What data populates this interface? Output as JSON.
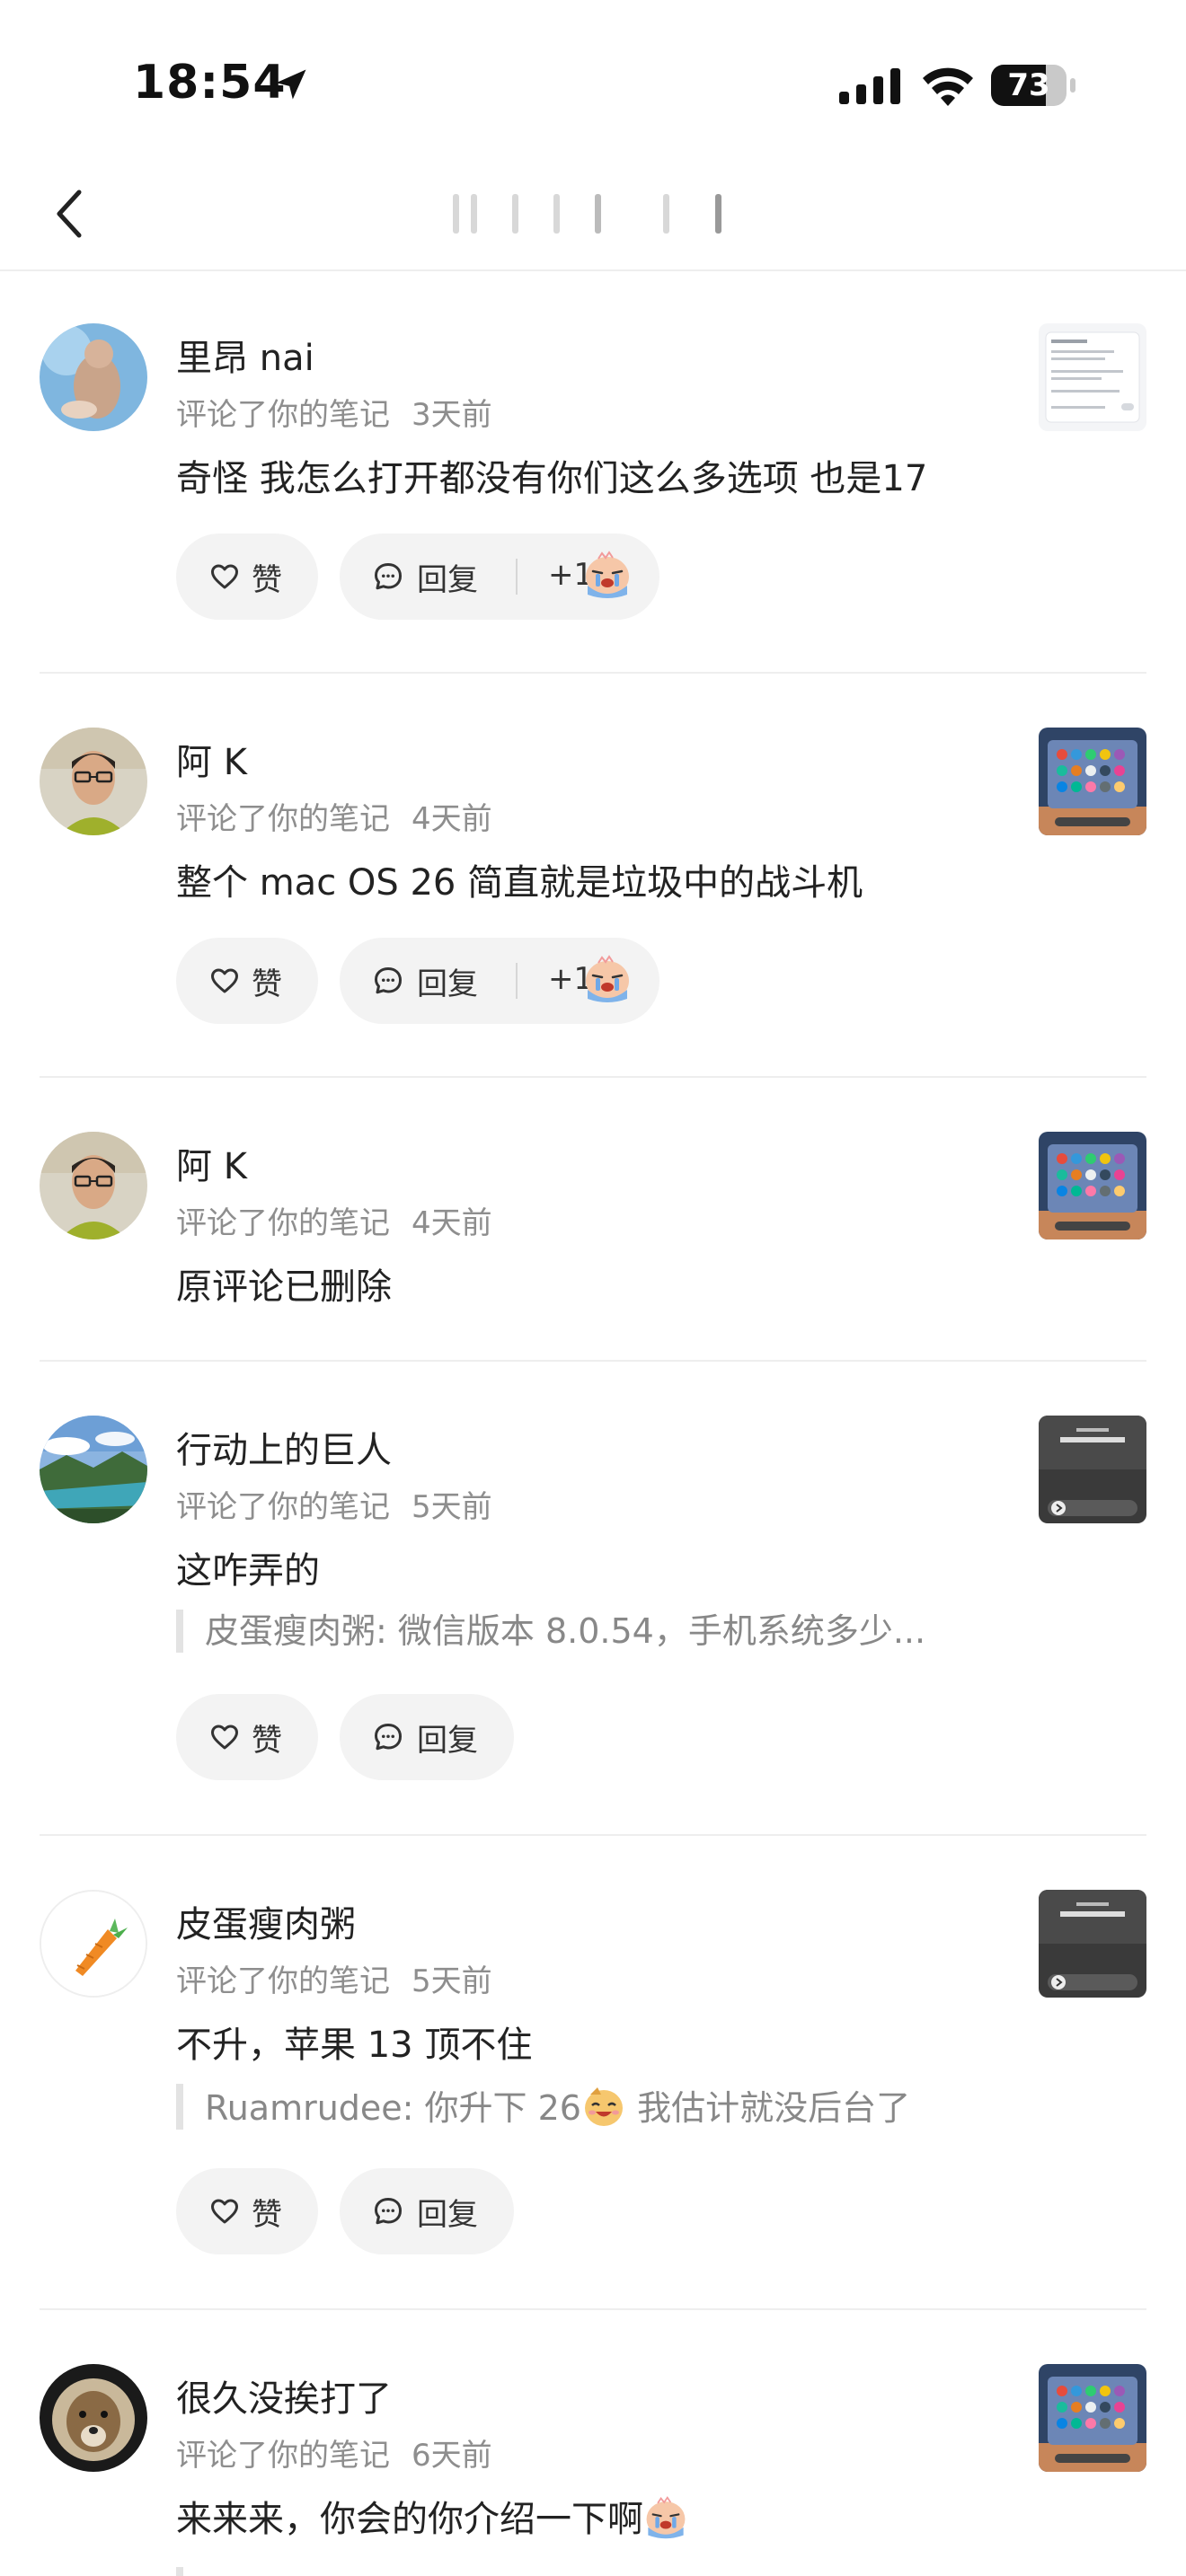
{
  "status_bar": {
    "time": "18:54",
    "battery": "73",
    "battery_level": 0.73,
    "icons": [
      "location-arrow-icon",
      "cellular-signal-icon",
      "wifi-icon",
      "battery-icon"
    ]
  },
  "nav": {
    "back_icon": "chevron-left-icon",
    "title_obscured": true
  },
  "actions": {
    "like": "赞",
    "reply": "回复"
  },
  "notifications": [
    {
      "username": "里昂 nai",
      "action": "评论了你的笔记",
      "time": "3天前",
      "comment": "奇怪 我怎么打开都没有你们这么多选项 也是17",
      "reaction_count": "+1",
      "reaction_emoji": "crying-emoji"
    },
    {
      "username": "阿 K",
      "action": "评论了你的笔记",
      "time": "4天前",
      "comment": "整个 mac OS 26 简直就是垃圾中的战斗机",
      "reaction_count": "+1",
      "reaction_emoji": "crying-emoji"
    },
    {
      "username": "阿 K",
      "action": "评论了你的笔记",
      "time": "4天前",
      "comment": "原评论已删除"
    },
    {
      "username": "行动上的巨人",
      "action": "评论了你的笔记",
      "time": "5天前",
      "comment": "这咋弄的",
      "quote": "皮蛋瘦肉粥: 微信版本 8.0.54，手机系统多少..."
    },
    {
      "username": "皮蛋瘦肉粥",
      "action": "评论了你的笔记",
      "time": "5天前",
      "comment": "不升，苹果 13 顶不住",
      "quote_before": "Ruamrudee: 你升下 26",
      "quote_emoji": "laughing-emoji",
      "quote_after": " 我估计就没后台了"
    },
    {
      "username": "很久没挨打了",
      "action": "评论了你的笔记",
      "time": "6天前",
      "comment": "来来来，你会的你介绍一下啊",
      "comment_emoji": "crying-emoji"
    }
  ],
  "colors": {
    "text_primary": "#222222",
    "text_secondary": "#8e8e8e",
    "pill_background": "#f3f3f3",
    "divider": "#eeeeee"
  }
}
